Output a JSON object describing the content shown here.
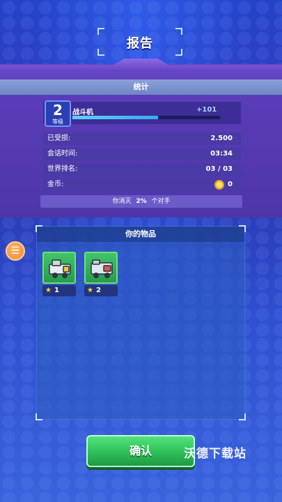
{
  "header": {
    "title": "报告"
  },
  "stats_section": {
    "title": "统计"
  },
  "level": {
    "number": "2",
    "label": "等级",
    "rank_name": "战斗机",
    "xp_gain": "+101",
    "progress": 0.58
  },
  "stats": [
    {
      "label": "已受损:",
      "value": "2.500"
    },
    {
      "label": "会话时间:",
      "value": "03:34"
    },
    {
      "label": "世界排名:",
      "value": "03 / 03"
    },
    {
      "label": "金币:",
      "value": "0"
    }
  ],
  "destroy_line": {
    "prefix": "你消灭",
    "percent": "2%",
    "suffix": "个对手"
  },
  "items_panel": {
    "title": "你的物品",
    "items": [
      {
        "count": "1",
        "icon": "robot-part-green-icon"
      },
      {
        "count": "2",
        "icon": "robot-part-red-icon"
      }
    ]
  },
  "confirm_label": "确认",
  "watermark": "沃德下载站",
  "colors": {
    "accent_green": "#2fbf58",
    "panel_purple": "#4a3aa6",
    "xp_blue": "#5fd2ff"
  }
}
